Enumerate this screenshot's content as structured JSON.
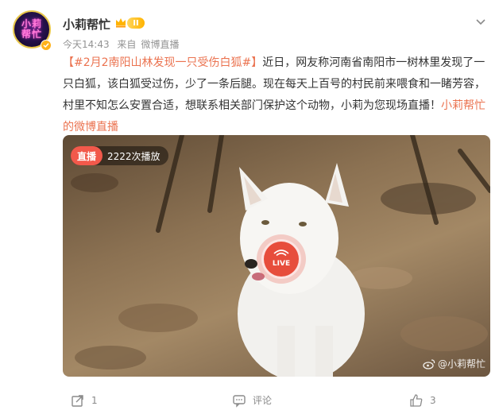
{
  "author": {
    "name": "小莉帮忙",
    "avatar_text": "小莉帮忙",
    "level": "II"
  },
  "meta": {
    "time": "今天14:43",
    "source_prefix": "来自",
    "source": "微博直播"
  },
  "post": {
    "topic": "【#2月2南阳山林发现一只受伤白狐#】",
    "body": "近日，网友称河南省南阳市一树林里发现了一只白狐，该白狐受过伤，少了一条后腿。现在每天上百号的村民前来喂食和一睹芳容，村里不知怎么安置合适，想联系相关部门保护这个动物，小莉为您现场直播！",
    "link": "小莉帮忙的微博直播"
  },
  "video": {
    "live_tag": "直播",
    "play_count": "2222次播放",
    "live_button": "LIVE",
    "watermark": "@小莉帮忙"
  },
  "actions": {
    "share_count": "1",
    "comment_label": "评论",
    "like_count": "3"
  },
  "colors": {
    "accent": "#eb7350",
    "live_red": "#e74d3c",
    "text": "#333333",
    "muted": "#939393"
  }
}
